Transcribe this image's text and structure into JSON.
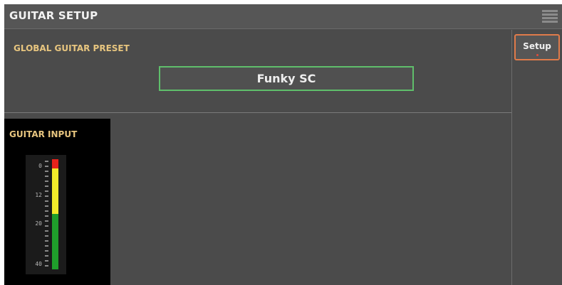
{
  "header": {
    "title": "GUITAR SETUP",
    "menu_icon": "menu-lines-icon"
  },
  "global_preset": {
    "section_label": "GLOBAL GUITAR PRESET",
    "value": "Funky SC"
  },
  "sidebar": {
    "tabs": [
      {
        "label": "Setup",
        "active": true
      }
    ]
  },
  "guitar_input": {
    "label": "GUITAR INPUT",
    "scale_labels": [
      "0",
      "12",
      "20",
      "40"
    ],
    "level_percent": 100
  },
  "colors": {
    "accent_label": "#e7c57f",
    "preset_border": "#5fbf6b",
    "tab_border": "#e07b4a",
    "meter_red": "#e5231b",
    "meter_yellow": "#f2ea2a",
    "meter_green": "#1f9e2b"
  }
}
